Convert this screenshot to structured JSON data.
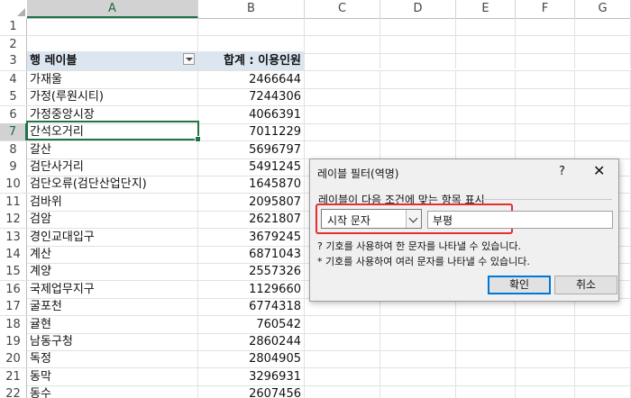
{
  "columns": [
    "A",
    "B",
    "C",
    "D",
    "E",
    "F",
    "G"
  ],
  "pivot": {
    "row_label_header": "행 레이블",
    "value_header": "합계 : 이용인원",
    "rows": [
      {
        "row": "4",
        "label": "가재울",
        "value": "2466644"
      },
      {
        "row": "5",
        "label": "가정(루원시티)",
        "value": "7244306"
      },
      {
        "row": "6",
        "label": "가정중앙시장",
        "value": "4066391"
      },
      {
        "row": "7",
        "label": "간석오거리",
        "value": "7011229"
      },
      {
        "row": "8",
        "label": "갈산",
        "value": "5696797"
      },
      {
        "row": "9",
        "label": "검단사거리",
        "value": "5491245"
      },
      {
        "row": "10",
        "label": "검단오류(검단산업단지)",
        "value": "1645870"
      },
      {
        "row": "11",
        "label": "검바위",
        "value": "2095807"
      },
      {
        "row": "12",
        "label": "검암",
        "value": "2621807"
      },
      {
        "row": "13",
        "label": "경인교대입구",
        "value": "3679245"
      },
      {
        "row": "14",
        "label": "계산",
        "value": "6871043"
      },
      {
        "row": "15",
        "label": "계양",
        "value": "2557326"
      },
      {
        "row": "16",
        "label": "국제업무지구",
        "value": "1129660"
      },
      {
        "row": "17",
        "label": "굴포천",
        "value": "6774318"
      },
      {
        "row": "18",
        "label": "귤현",
        "value": "760542"
      },
      {
        "row": "19",
        "label": "남동구청",
        "value": "2860244"
      },
      {
        "row": "20",
        "label": "독정",
        "value": "2804905"
      },
      {
        "row": "21",
        "label": "동막",
        "value": "3296931"
      },
      {
        "row": "22",
        "label": "동수",
        "value": "2607456"
      }
    ]
  },
  "row_numbers": [
    "1",
    "2",
    "3"
  ],
  "dialog": {
    "title": "레이블 필터(역명)",
    "help": "?",
    "close": "✕",
    "group_label": "레이블이 다음 조건에 맞는 항목 표시",
    "condition": "시작 문자",
    "value": "부평",
    "hint1": "? 기호를 사용하여 한 문자를 나타낼 수 있습니다.",
    "hint2": "* 기호를 사용하여 여러 문자를 나타낼 수 있습니다.",
    "ok": "확인",
    "cancel": "취소"
  },
  "colors": {
    "accent": "#217346",
    "pivot_header": "#dce6f1",
    "highlight": "#e03030",
    "ok_border": "#0078d7"
  }
}
